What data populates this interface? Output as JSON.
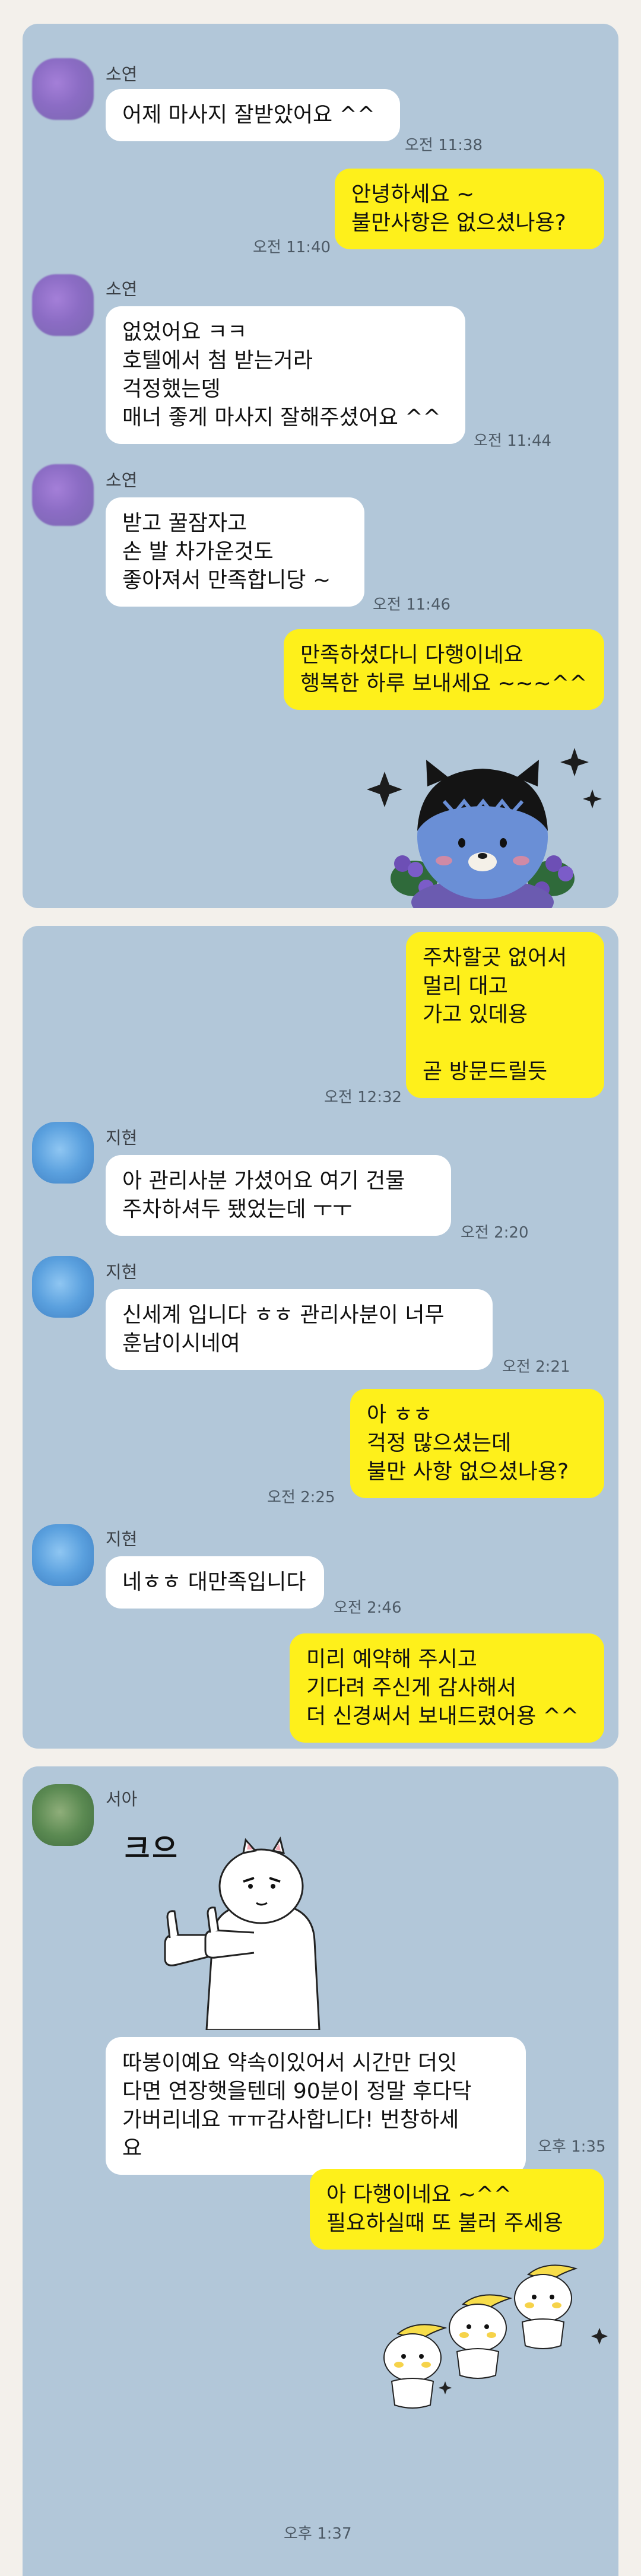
{
  "panel1": {
    "messages": [
      {
        "sender": "소연",
        "text": "어제 마사지 잘받았어요 ^^",
        "time": "오전 11:38"
      },
      {
        "text": "안녕하세요 ~\n불만사항은 없으셨나용?",
        "time": "오전 11:40"
      },
      {
        "sender": "소연",
        "text": "없었어요 ㅋㅋ\n호텔에서 첨 받는거라\n걱정했는뎅\n매너 좋게 마사지 잘해주셨어요 ^^",
        "time": "오전 11:44"
      },
      {
        "sender": "소연",
        "text": "받고 꿀잠자고\n손 발 차가운것도\n좋아져서 만족합니당 ~",
        "time": "오전 11:46"
      },
      {
        "text": "만족하셨다니 다행이네요\n행복한 하루 보내세요 ~~~^^"
      }
    ]
  },
  "panel2": {
    "messages": [
      {
        "text": "주차할곳 없어서\n멀리 대고\n가고 있데용\n\n곧 방문드릴듯",
        "time": "오전 12:32"
      },
      {
        "sender": "지현",
        "text": "아 관리사분 가셨어요 여기 건물\n주차하셔두 됐었는데 ㅜㅜ",
        "time": "오전 2:20"
      },
      {
        "sender": "지현",
        "text": "신세계 입니다 ㅎㅎ 관리사분이 너무\n훈남이시네여",
        "time": "오전 2:21"
      },
      {
        "text": "아 ㅎㅎ\n걱정 많으셨는데\n불만 사항 없으셨나용?",
        "time": "오전 2:25"
      },
      {
        "sender": "지현",
        "text": "네ㅎㅎ 대만족입니다",
        "time": "오전 2:46"
      },
      {
        "text": "미리 예약해 주시고\n기다려 주신게 감사해서\n더 신경써서 보내드렸어용 ^^"
      }
    ]
  },
  "panel3": {
    "sender": "서아",
    "sticker_text": "크으",
    "messages": [
      {
        "text": "따봉이예요 약속이있어서 시간만 더잇\n다면 연장햇을텐데 90분이 정말 후다닥\n가버리네요 ㅠㅠ감사합니다! 번창하세\n요",
        "time": "오후 1:35"
      },
      {
        "text": "아 다행이네요 ~^^\n필요하실때 또 불러 주세용"
      }
    ],
    "last_time": "오후 1:37"
  },
  "colors": {
    "bg": "#b2c7d9",
    "mine": "#fef01b",
    "theirs": "#ffffff"
  }
}
